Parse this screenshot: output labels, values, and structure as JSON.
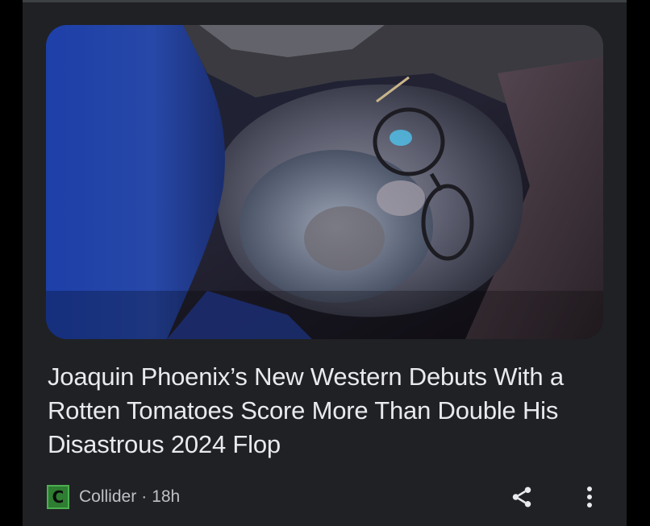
{
  "article": {
    "headline": "Joaquin Phoenix’s New Western Debuts With a Rotten Tomatoes Score More Than Double His Disastrous 2024 Flop",
    "image_alt": "Man with glasses and grey beard lying down in dim blue light",
    "source": {
      "logo_letter": "C",
      "name": "Collider",
      "separator": "·",
      "age": "18h"
    },
    "actions": {
      "share_icon": "share-icon",
      "more_icon": "more-vert-icon"
    }
  },
  "colors": {
    "card_background": "#202124",
    "headline_text": "#e8eaed",
    "meta_text": "#bdc1c6",
    "source_logo": "#2e7d32"
  }
}
